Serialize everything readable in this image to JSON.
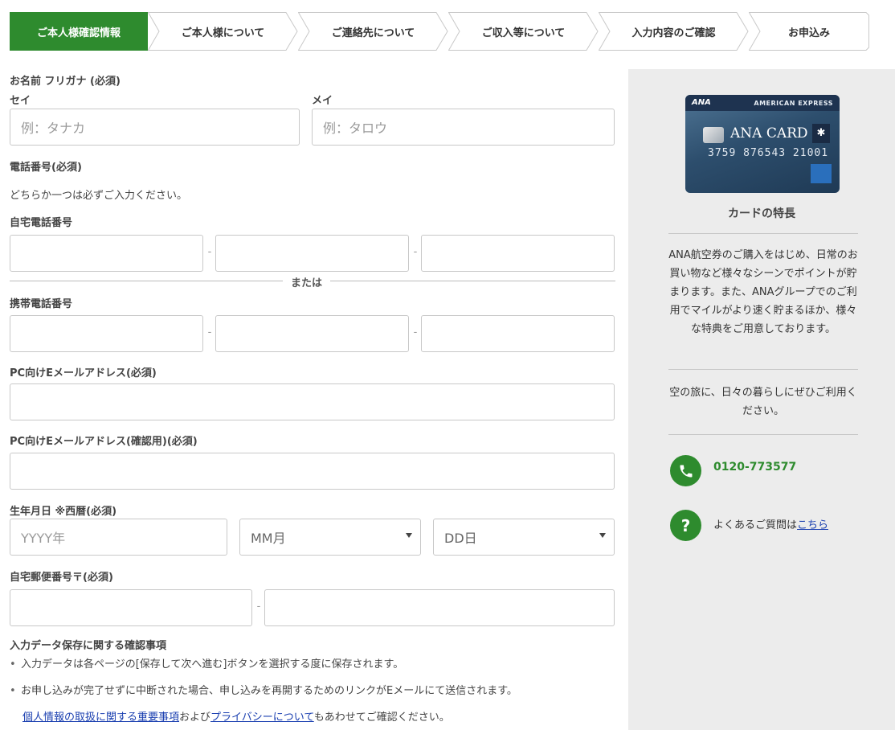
{
  "colors": {
    "accent_green": "#2e8b2e",
    "link_blue": "#1a3fb0",
    "sidebar_bg": "#ececec"
  },
  "steps": [
    {
      "label": "ご本人様確認情報",
      "active": true
    },
    {
      "label": "ご本人様について",
      "active": false
    },
    {
      "label": "ご連絡先について",
      "active": false
    },
    {
      "label": "ご収入等について",
      "active": false
    },
    {
      "label": "入力内容のご確認",
      "active": false
    },
    {
      "label": "お申込み",
      "active": false
    }
  ],
  "form": {
    "name_kana_label": "お名前 フリガナ (必須)",
    "sei_label": "セイ",
    "mei_label": "メイ",
    "sei_placeholder": "例：タナカ",
    "mei_placeholder": "例：タロウ",
    "phone_label": "電話番号(必須)",
    "phone_note": "どちらか一つは必ずご入力ください。",
    "home_phone_label": "自宅電話番号",
    "or_label": "または",
    "mobile_phone_label": "携帯電話番号",
    "dash": "-",
    "email_label": "PC向けEメールアドレス(必須)",
    "email_confirm_label": "PC向けEメールアドレス(確認用)(必須)",
    "birth_label": "生年月日 ※西暦(必須)",
    "year_placeholder": "YYYY年",
    "month_selected": "MM月",
    "day_selected": "DD日",
    "postal_label": "自宅郵便番号〒(必須)",
    "note_title": "入力データ保存に関する確認事項",
    "bullet_1": "入力データは各ページの[保存して次へ進む]ボタンを選択する度に保存されます。",
    "bullet_2": "お申し込みが完了せずに中断された場合、申し込みを再開するためのリンクがEメールにて送信されます。",
    "bullet_mark": "•",
    "link_1": "個人情報の取扱に関する重要事項",
    "link_text_mid": "および",
    "link_2": "プライバシーについて",
    "link_text_end": "もあわせてご確認ください。"
  },
  "sidebar": {
    "card": {
      "brand_ana": "ANA",
      "brand_amex": "AMERICAN EXPRESS",
      "name": "ANA CARD",
      "number": "3759 876543 21001"
    },
    "title": "カードの特長",
    "desc": "ANA航空券のご購入をはじめ、日常のお買い物など様々なシーンでポイントが貯まります。また、ANAグループでのご利用でマイルがより速く貯まるほか、様々な特典をご用意しております。",
    "tagline": "空の旅に、日々の暮らしにぜひご利用ください。",
    "phone": "0120-773577",
    "faq_text": "よくあるご質問は",
    "faq_link": "こちら",
    "faq_icon": "?"
  }
}
